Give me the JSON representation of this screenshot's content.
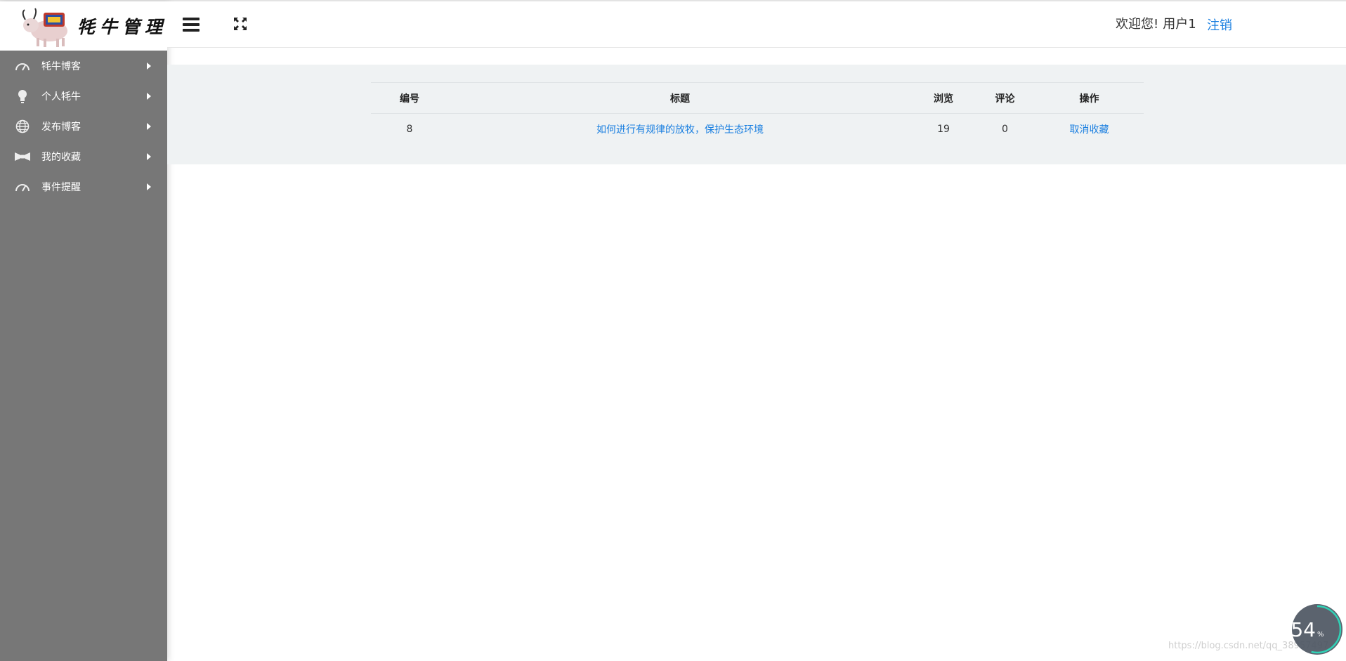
{
  "app": {
    "logo_text": "牦牛管理"
  },
  "sidebar": {
    "items": [
      {
        "label": "牦牛博客",
        "icon": "dashboard-icon"
      },
      {
        "label": "个人牦牛",
        "icon": "lightbulb-icon"
      },
      {
        "label": "发布博客",
        "icon": "globe-icon"
      },
      {
        "label": "我的收藏",
        "icon": "bowtie-icon"
      },
      {
        "label": "事件提醒",
        "icon": "dashboard-icon"
      }
    ]
  },
  "header": {
    "welcome_text": "欢迎您!",
    "username": "用户1",
    "logout_label": "注销"
  },
  "table": {
    "headers": [
      "编号",
      "标题",
      "浏览",
      "评论",
      "操作"
    ],
    "rows": [
      {
        "id": "8",
        "title": "如何进行有规律的放牧，保护生态环境",
        "views": "19",
        "comments": "0",
        "action": "取消收藏"
      }
    ]
  },
  "badge": {
    "percent_number": "54",
    "percent_sign": "%",
    "progress": 0.54
  },
  "watermark": "https://blog.csdn.net/qq_38957497",
  "colors": {
    "sidebar_bg": "#777777",
    "link": "#1a7fe0",
    "panel_bg": "#eff2f3"
  }
}
